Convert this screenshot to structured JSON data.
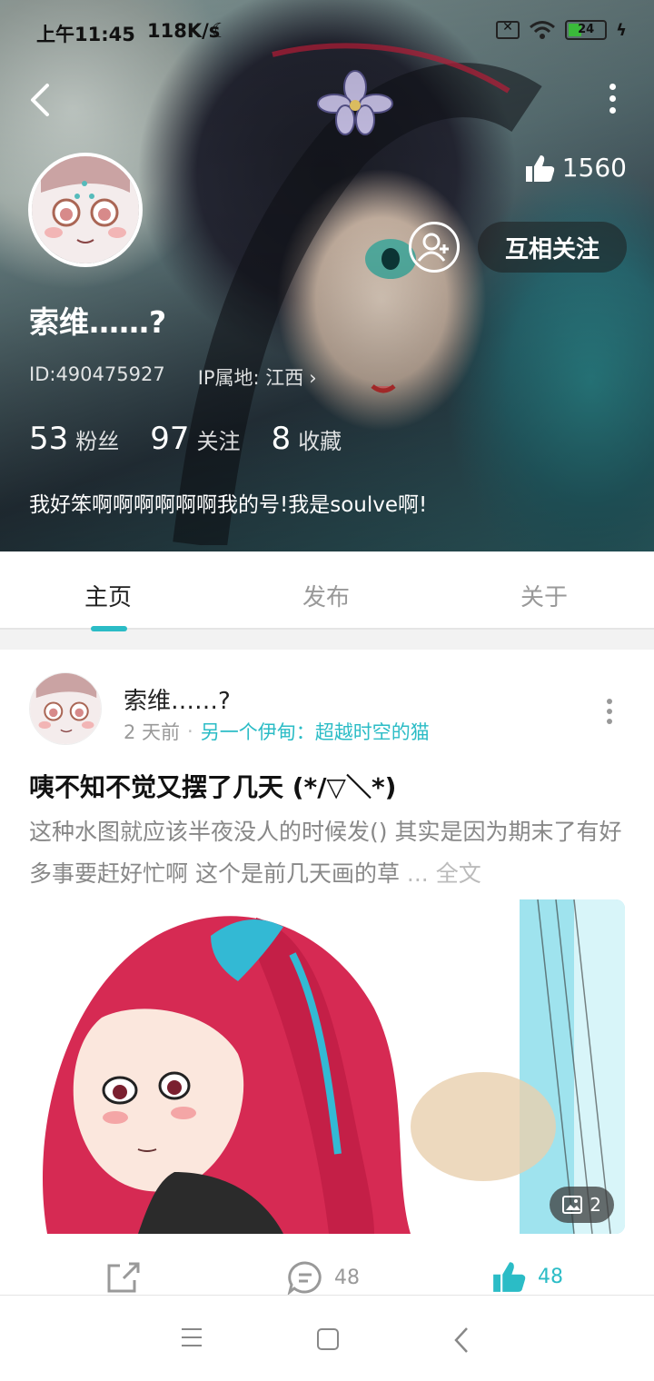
{
  "status_bar": {
    "time": "上午11:45",
    "speed": "118K/s",
    "battery": "24"
  },
  "header": {
    "likes_count": "1560",
    "follow_label": "互相关注",
    "user_name": "索维……?",
    "user_id": "ID:490475927",
    "ip_location": "IP属地: 江西",
    "stats": [
      {
        "value": "53",
        "label": "粉丝"
      },
      {
        "value": "97",
        "label": "关注"
      },
      {
        "value": "8",
        "label": "收藏"
      }
    ],
    "bio": "我好笨啊啊啊啊啊啊我的号!我是soulve啊!"
  },
  "tabs": [
    {
      "label": "主页",
      "active": true
    },
    {
      "label": "发布",
      "active": false
    },
    {
      "label": "关于",
      "active": false
    }
  ],
  "post": {
    "author": "索维……?",
    "time": "2 天前",
    "separator": "·",
    "topic": "另一个伊甸：超越时空的猫",
    "title": "咦不知不觉又摆了几天 (*/▽＼*)",
    "body": "这种水图就应该半夜没人的时候发() 其实是因为期末了有好多事要赶好忙啊 这个是前几天画的草",
    "ellipsis": "...",
    "full_text_label": "全文",
    "image_count": "2",
    "actions": {
      "share_count": "",
      "comment_count": "48",
      "like_count": "48"
    }
  },
  "colors": {
    "accent": "#2bbcc6",
    "muted_text": "#999999"
  }
}
